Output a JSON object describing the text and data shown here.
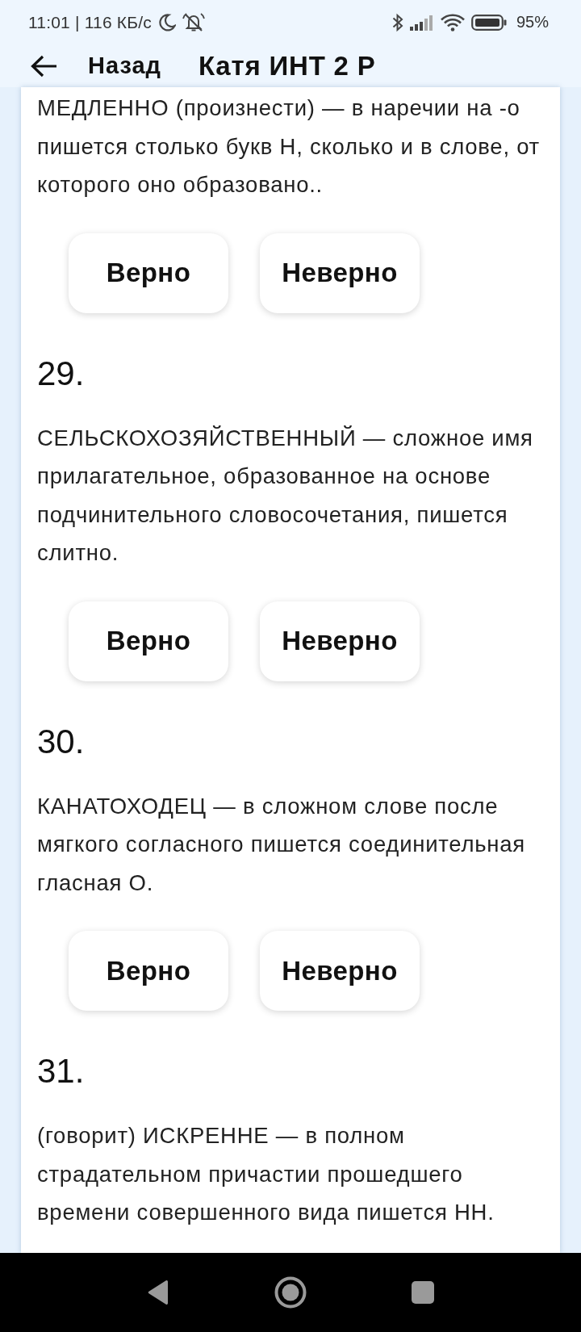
{
  "status_bar": {
    "time": "11:01 | 116 КБ/с",
    "battery": "95%"
  },
  "header": {
    "back_label": "Назад",
    "title": "Катя ИНТ 2 Р"
  },
  "questions": [
    {
      "text": "МЕДЛЕННО (произнести) — в наречии на -о пишется столько букв Н, сколько и в слове, от которого оно образовано..",
      "buttons": [
        "Верно",
        "Неверно"
      ]
    },
    {
      "number": "29.",
      "text": "СЕЛЬСКОХОЗЯЙСТВЕННЫЙ — сложное имя прилагательное, образованное на основе подчинительного словосочетания, пишется слитно.",
      "buttons": [
        "Верно",
        "Неверно"
      ]
    },
    {
      "number": "30.",
      "text": "КАНАТОХОДЕЦ — в сложном слове после мягкого согласного пишется соединительная гласная О.",
      "buttons": [
        "Верно",
        "Неверно"
      ]
    },
    {
      "number": "31.",
      "text": "(говорит) ИСКРЕННЕ — в полном страдательном причастии прошедшего времени совершенного вида пишется НН."
    }
  ]
}
